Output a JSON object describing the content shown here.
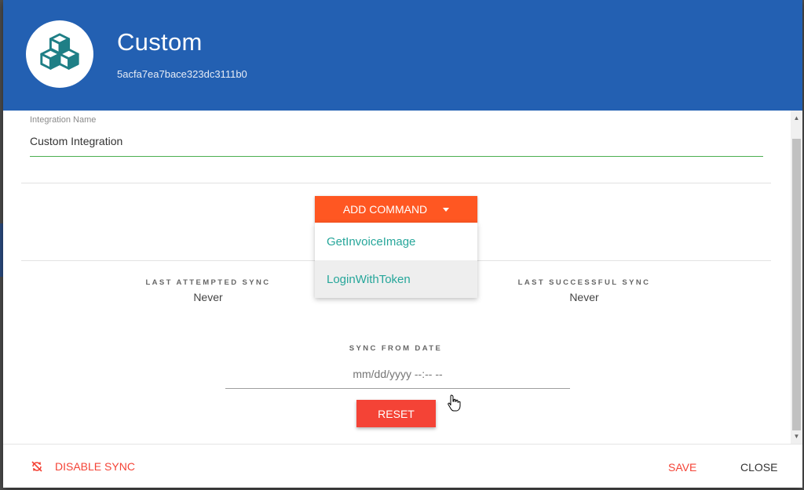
{
  "header": {
    "title": "Custom",
    "integration_id": "5acfa7ea7bace323dc3111b0",
    "logo_icon": "cubes-icon"
  },
  "form": {
    "integration_name_label": "Integration Name",
    "integration_name_value": "Custom Integration"
  },
  "add_command": {
    "label": "ADD COMMAND",
    "menu_items": [
      "GetInvoiceImage",
      "LoginWithToken"
    ],
    "hovered_item": "LoginWithToken"
  },
  "sync": {
    "last_attempted_label": "LAST ATTEMPTED SYNC",
    "last_attempted_value": "Never",
    "last_successful_label": "LAST SUCCESSFUL SYNC",
    "last_successful_value": "Never",
    "sync_from_label": "SYNC FROM DATE",
    "sync_from_placeholder": "mm/dd/yyyy --:-- --",
    "reset_label": "RESET"
  },
  "footer": {
    "disable_sync_label": "DISABLE SYNC",
    "save_label": "SAVE",
    "close_label": "CLOSE"
  },
  "colors": {
    "header_bg": "#2360b2",
    "add_button": "#ff5722",
    "reset_button": "#f44336",
    "menu_text": "#26a69a",
    "input_underline": "#4caf50"
  }
}
